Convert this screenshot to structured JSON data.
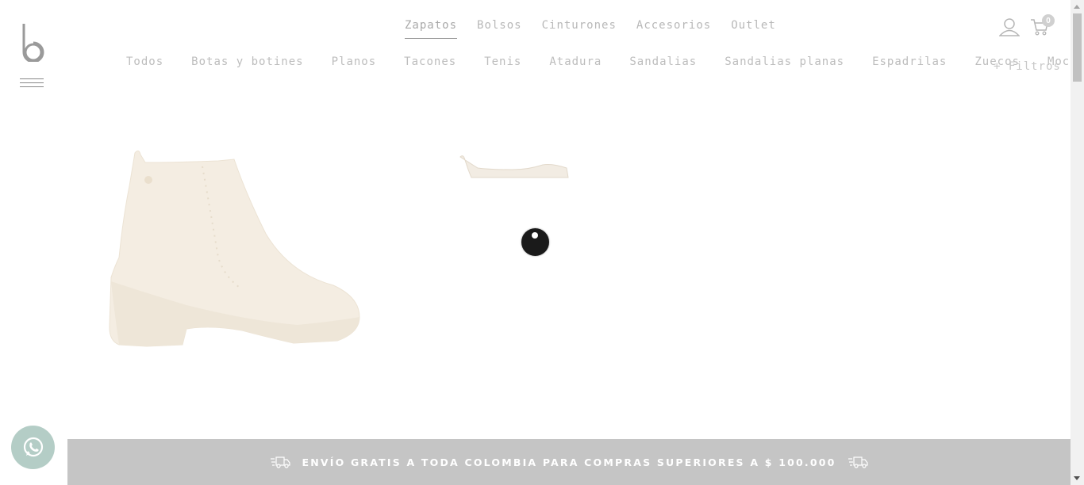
{
  "nav": {
    "main": [
      {
        "label": "Zapatos",
        "active": true
      },
      {
        "label": "Bolsos",
        "active": false
      },
      {
        "label": "Cinturones",
        "active": false
      },
      {
        "label": "Accesorios",
        "active": false
      },
      {
        "label": "Outlet",
        "active": false
      }
    ],
    "sub": [
      {
        "label": "Todos"
      },
      {
        "label": "Botas y botines"
      },
      {
        "label": "Planos"
      },
      {
        "label": "Tacones"
      },
      {
        "label": "Tenis"
      },
      {
        "label": "Atadura"
      },
      {
        "label": "Sandalias"
      },
      {
        "label": "Sandalias planas"
      },
      {
        "label": "Espadrilas"
      },
      {
        "label": "Zuecos"
      },
      {
        "label": "Mocasines"
      }
    ],
    "filters_label": "+ Filtros"
  },
  "header": {
    "cart_count": "0",
    "icons": [
      "user-icon",
      "cart-icon"
    ]
  },
  "banner": {
    "text": "ENVÍO GRATIS A TODA COLOMBIA PARA COMPRAS SUPERIORES A $ 100.000"
  },
  "colors": {
    "banner_bg": "#c5c5c5",
    "whatsapp_bg": "#b4cdc6",
    "product_tint": "#f3ebe0"
  }
}
